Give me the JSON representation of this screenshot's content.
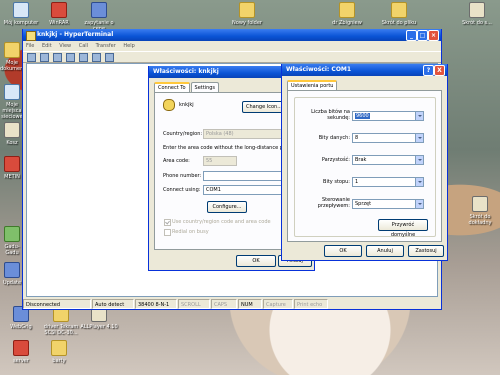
{
  "desktop": {
    "icons": [
      {
        "id": "moj-komputer",
        "label": "Mój komputer"
      },
      {
        "id": "winrar",
        "label": "WinRAR"
      },
      {
        "id": "zapytanie",
        "label": "zapytanie o cenę"
      },
      {
        "id": "nowy-folder",
        "label": "Nowy folder"
      },
      {
        "id": "dr-zbigniew",
        "label": "dr Zbigniew"
      },
      {
        "id": "skrot-do-pliku",
        "label": "Skrót do pliku"
      },
      {
        "id": "skrot-do-s",
        "label": "Skrót do s..."
      },
      {
        "id": "moje-dokumenty",
        "label": "Moje dokumenty"
      },
      {
        "id": "moje-miejsca",
        "label": "Moje miejsca sieciowe"
      },
      {
        "id": "kosz",
        "label": "Kosz"
      },
      {
        "id": "metin",
        "label": "METIN"
      },
      {
        "id": "gadu",
        "label": "Gadu-Gadu"
      },
      {
        "id": "update",
        "label": "Update"
      },
      {
        "id": "webgrig",
        "label": "WebGrig"
      },
      {
        "id": "driver-tekram",
        "label": "driver Tekram SCSI DC-30..."
      },
      {
        "id": "allplayer",
        "label": "ALLPlayer 4.10"
      },
      {
        "id": "server",
        "label": "server"
      },
      {
        "id": "barty",
        "label": "barty"
      },
      {
        "id": "skrot-label",
        "label": "Skrót do"
      },
      {
        "id": "dokladny",
        "label": "dokładny"
      }
    ]
  },
  "hyperterminal": {
    "title": "knkjkj - HyperTerminal",
    "menu": [
      "File",
      "Edit",
      "View",
      "Call",
      "Transfer",
      "Help"
    ],
    "status": {
      "connection": "Disconnected",
      "detect": "Auto detect",
      "settings": "38400 8-N-1",
      "scroll": "SCROLL",
      "caps": "CAPS",
      "num": "NUM",
      "capture": "Capture",
      "print": "Print echo"
    }
  },
  "props_knkjkj": {
    "title": "Właściwości: knkjkj",
    "tabs": [
      "Connect To",
      "Settings"
    ],
    "connection_name": "knkjkj",
    "change_icon_label": "Change Icon...",
    "country_label": "Country/region:",
    "country_value": "Polska (48)",
    "hint": "Enter the area code without the long-distance prefix.",
    "area_code_label": "Area code:",
    "area_code_value": "55",
    "phone_label": "Phone number:",
    "phone_value": "",
    "connect_using_label": "Connect using:",
    "connect_using_value": "COM1",
    "configure_label": "Configure...",
    "use_country_label": "Use country/region code and area code",
    "redial_label": "Redial on busy",
    "ok_label": "OK",
    "cancel_label": "Anuluj"
  },
  "props_com1": {
    "title": "Właściwości: COM1",
    "help_glyph": "?",
    "close_glyph": "X",
    "tab": "Ustawienia portu",
    "fields": [
      {
        "label": "Liczba bitów na sekundę:",
        "value": "9600",
        "selected": true
      },
      {
        "label": "Bity danych:",
        "value": "8",
        "selected": false
      },
      {
        "label": "Parzystość:",
        "value": "Brak",
        "selected": false
      },
      {
        "label": "Bity stopu:",
        "value": "1",
        "selected": false
      },
      {
        "label": "Sterowanie przepływem:",
        "value": "Sprzęt",
        "selected": false
      }
    ],
    "restore_label": "Przywróć domyślne",
    "ok_label": "OK",
    "cancel_label": "Anuluj",
    "apply_label": "Zastosuj"
  }
}
